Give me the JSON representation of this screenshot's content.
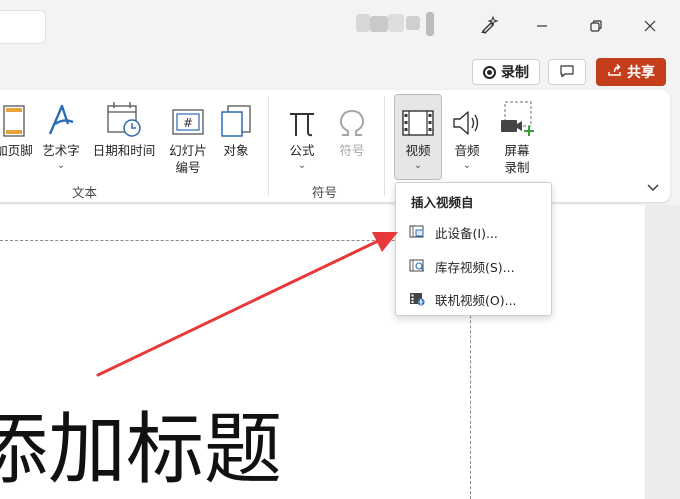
{
  "actions": {
    "record_label": "录制",
    "share_label": "共享"
  },
  "ribbon": {
    "header_footer_label": "页眉和页脚",
    "header_footer_visible": "加页脚",
    "wordart_label": "艺术字",
    "datetime_label": "日期和时间",
    "slide_number_line1": "幻灯片",
    "slide_number_line2": "编号",
    "object_label": "对象",
    "equation_label": "公式",
    "symbol_label": "符号",
    "video_label": "视频",
    "audio_label": "音频",
    "screen_rec_line1": "屏幕",
    "screen_rec_line2": "录制",
    "group_text": "文本",
    "group_symbols": "符号"
  },
  "dropdown": {
    "header": "插入视频自",
    "items": [
      {
        "label": "此设备(I)...",
        "icon": "device-video-icon"
      },
      {
        "label": "库存视频(S)...",
        "icon": "stock-video-icon"
      },
      {
        "label": "联机视频(O)...",
        "icon": "online-video-icon"
      }
    ]
  },
  "slide": {
    "title_placeholder": "添加标题"
  },
  "colors": {
    "accent_blue": "#2b6cb3",
    "share_red": "#c43e1c",
    "arrow_red": "#e8393a"
  }
}
